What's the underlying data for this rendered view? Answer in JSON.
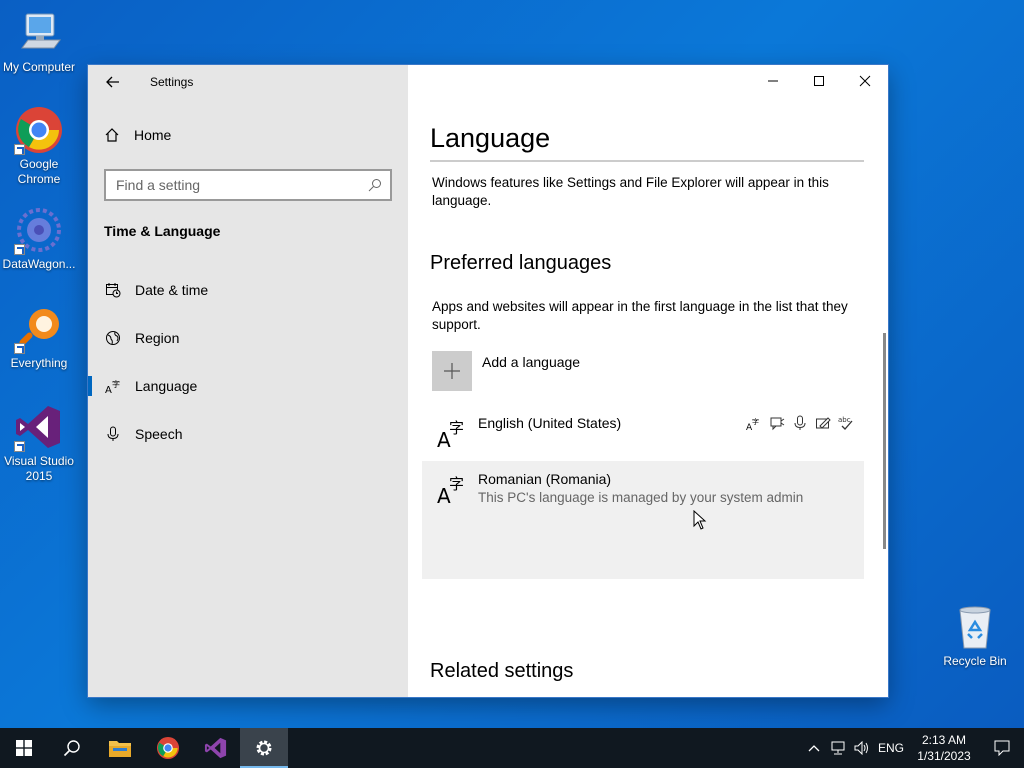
{
  "desktop": {
    "icons": [
      {
        "label": "My Computer"
      },
      {
        "label": "Google Chrome"
      },
      {
        "label": "DataWagon..."
      },
      {
        "label": "Everything"
      },
      {
        "label": "Visual Studio 2015"
      },
      {
        "label": "Recycle Bin"
      }
    ]
  },
  "settings": {
    "app_title": "Settings",
    "nav": {
      "home": "Home",
      "search_placeholder": "Find a setting",
      "section": "Time & Language",
      "items": [
        {
          "label": "Date & time",
          "icon": "calendar-clock-icon"
        },
        {
          "label": "Region",
          "icon": "globe-icon"
        },
        {
          "label": "Language",
          "icon": "language-icon",
          "active": true
        },
        {
          "label": "Speech",
          "icon": "microphone-icon"
        }
      ]
    },
    "content": {
      "title": "Language",
      "intro": "Windows features like Settings and File Explorer will appear in this language.",
      "preferred_heading": "Preferred languages",
      "preferred_desc": "Apps and websites will appear in the first language in the list that they support.",
      "add_language": "Add a language",
      "languages": [
        {
          "name": "English (United States)",
          "features": [
            "display-language-icon",
            "text-to-speech-icon",
            "speech-icon",
            "handwriting-icon",
            "spell-check-icon"
          ]
        },
        {
          "name": "Romanian (Romania)",
          "note": "This PC's language is managed by your system admin"
        }
      ],
      "related_heading": "Related settings"
    }
  },
  "taskbar": {
    "apps": [
      "windows-start-icon",
      "search-icon",
      "file-explorer-icon",
      "chrome-icon",
      "visual-studio-icon",
      "settings-gear-icon"
    ],
    "tray": {
      "lang": "ENG",
      "time": "2:13 AM",
      "date": "1/31/2023"
    }
  },
  "colors": {
    "accent": "#0067c0",
    "desktop": "#0b78d8",
    "nav_bg": "#e6e6e6"
  }
}
